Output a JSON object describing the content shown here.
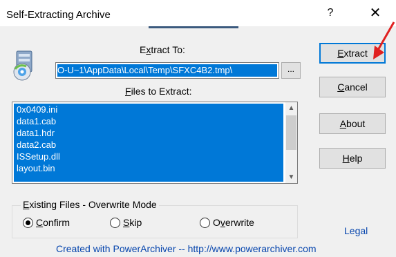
{
  "window": {
    "title": "Self-Extracting Archive",
    "help_label": "?",
    "close_label": "✕"
  },
  "extract": {
    "label_pre": "E",
    "label_ul": "x",
    "label_post": "tract To:",
    "path_value": "O-U~1\\AppData\\Local\\Temp\\SFXC4B2.tmp\\",
    "browse_label": "..."
  },
  "files": {
    "label_ul": "F",
    "label_post": "iles to Extract:",
    "items": [
      "0x0409.ini",
      "data1.cab",
      "data1.hdr",
      "data2.cab",
      "ISSetup.dll",
      "layout.bin"
    ]
  },
  "buttons": {
    "extract": {
      "ul": "E",
      "rest": "xtract"
    },
    "cancel": {
      "ul": "C",
      "rest": "ancel"
    },
    "about": {
      "ul": "A",
      "rest": "bout"
    },
    "help": {
      "ul": "H",
      "rest": "elp"
    }
  },
  "overwrite": {
    "title_ul": "E",
    "title_post": "xisting Files - Overwrite Mode",
    "options": [
      {
        "ul": "C",
        "rest": "onfirm",
        "selected": true
      },
      {
        "ul": "S",
        "rest": "kip",
        "selected": false
      },
      {
        "pre": "O",
        "ul": "v",
        "rest": "erwrite",
        "selected": false
      }
    ]
  },
  "footer": {
    "legal": "Legal",
    "credit": "Created with PowerArchiver  --  http://www.powerarchiver.com"
  },
  "colors": {
    "selection": "#0078d7",
    "dialog_bg": "#f0f0f0",
    "link": "#0645ad",
    "annotation_arrow": "#e02020"
  }
}
